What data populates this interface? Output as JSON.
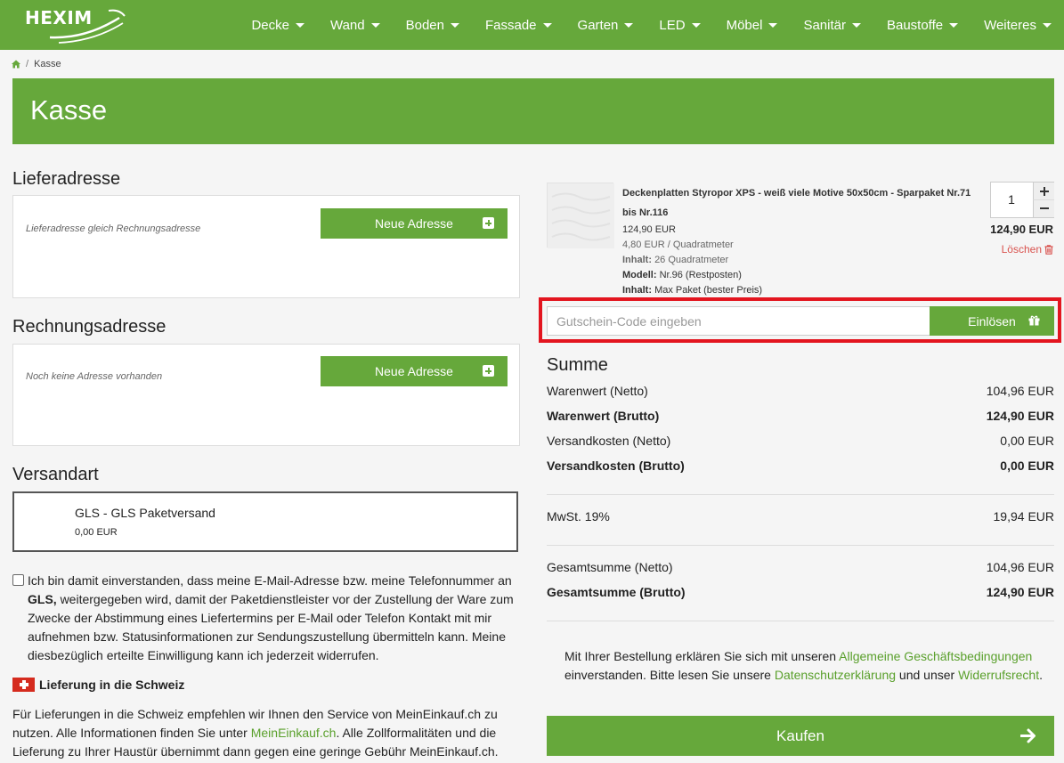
{
  "brand": {
    "name": "HEXIM"
  },
  "nav": {
    "items": [
      {
        "label": "Decke"
      },
      {
        "label": "Wand"
      },
      {
        "label": "Boden"
      },
      {
        "label": "Fassade"
      },
      {
        "label": "Garten"
      },
      {
        "label": "LED"
      },
      {
        "label": "Möbel"
      },
      {
        "label": "Sanitär"
      },
      {
        "label": "Baustoffe"
      },
      {
        "label": "Weiteres"
      }
    ]
  },
  "breadcrumb": {
    "separator": "/",
    "current": "Kasse"
  },
  "page": {
    "title": "Kasse"
  },
  "delivery": {
    "title": "Lieferadresse",
    "note": "Lieferadresse gleich Rechnungsadresse",
    "button": "Neue Adresse"
  },
  "billing": {
    "title": "Rechnungsadresse",
    "note": "Noch keine Adresse vorhanden",
    "button": "Neue Adresse"
  },
  "shipping": {
    "title": "Versandart",
    "option": "GLS - GLS Paketversand",
    "price": "0,00 EUR"
  },
  "consent": {
    "text_before": "Ich bin damit einverstanden, dass meine E-Mail-Adresse bzw. meine Telefonnummer an",
    "carrier": "GLS,",
    "text_after": "weitergegeben wird, damit der Paketdienstleister vor der Zustellung der Ware zum Zwecke der Abstimmung eines Liefertermins per E-Mail oder Telefon Kontakt mit mir aufnehmen bzw. Statusinformationen zur Sendungszustellung übermitteln kann. Meine diesbezüglich erteilte Einwilligung kann ich jederzeit widerrufen."
  },
  "swiss": {
    "title": "Lieferung in die Schweiz",
    "text_before": "Für Lieferungen in die Schweiz empfehlen wir Ihnen den Service von MeinEinkauf.ch zu nutzen. Alle Informationen finden Sie unter",
    "link": "MeinEinkauf.ch",
    "text_after": ". Alle Zollformalitäten und die Lieferung zu Ihrer Haustür übernimmt dann gegen eine geringe Gebühr MeinEinkauf.ch."
  },
  "cart": {
    "product": {
      "name": "Deckenplatten Styropor XPS - weiß viele Motive 50x50cm - Sparpaket Nr.71 bis Nr.116",
      "price": "124,90 EUR",
      "unit_price": "4,80 EUR / Quadratmeter",
      "content_label": "Inhalt:",
      "content_value": "26 Quadratmeter",
      "model_label": "Modell:",
      "model_value": "Nr.96 (Restposten)",
      "package_label": "Inhalt:",
      "package_value": "Max Paket (bester Preis)",
      "quantity": "1",
      "total": "124,90 EUR",
      "delete_label": "Löschen"
    }
  },
  "coupon": {
    "placeholder": "Gutschein-Code eingeben",
    "button": "Einlösen"
  },
  "summary": {
    "title": "Summe",
    "rows": [
      {
        "label": "Warenwert (Netto)",
        "value": "104,96 EUR"
      },
      {
        "label": "Warenwert (Brutto)",
        "value": "124,90 EUR"
      },
      {
        "label": "Versandkosten (Netto)",
        "value": "0,00 EUR"
      },
      {
        "label": "Versandkosten (Brutto)",
        "value": "0,00 EUR"
      },
      {
        "label": "MwSt. 19%",
        "value": "19,94 EUR"
      },
      {
        "label": "Gesamtsumme (Netto)",
        "value": "104,96 EUR"
      },
      {
        "label": "Gesamtsumme (Brutto)",
        "value": "124,90 EUR"
      }
    ]
  },
  "terms": {
    "text1": "Mit Ihrer Bestellung erklären Sie sich mit unseren",
    "link1": "Allgemeine Geschäftsbedingungen",
    "text2": "einverstanden. Bitte lesen Sie unsere",
    "link2": "Datenschutzerklärung",
    "text3": "und unser",
    "link3": "Widerrufsrecht",
    "text4": "."
  },
  "buy": {
    "label": "Kaufen"
  },
  "colors": {
    "brand_green": "#66a83b",
    "link_green": "#5aa02c",
    "highlight_red": "#e3151f",
    "delete_red": "#d9534f"
  }
}
